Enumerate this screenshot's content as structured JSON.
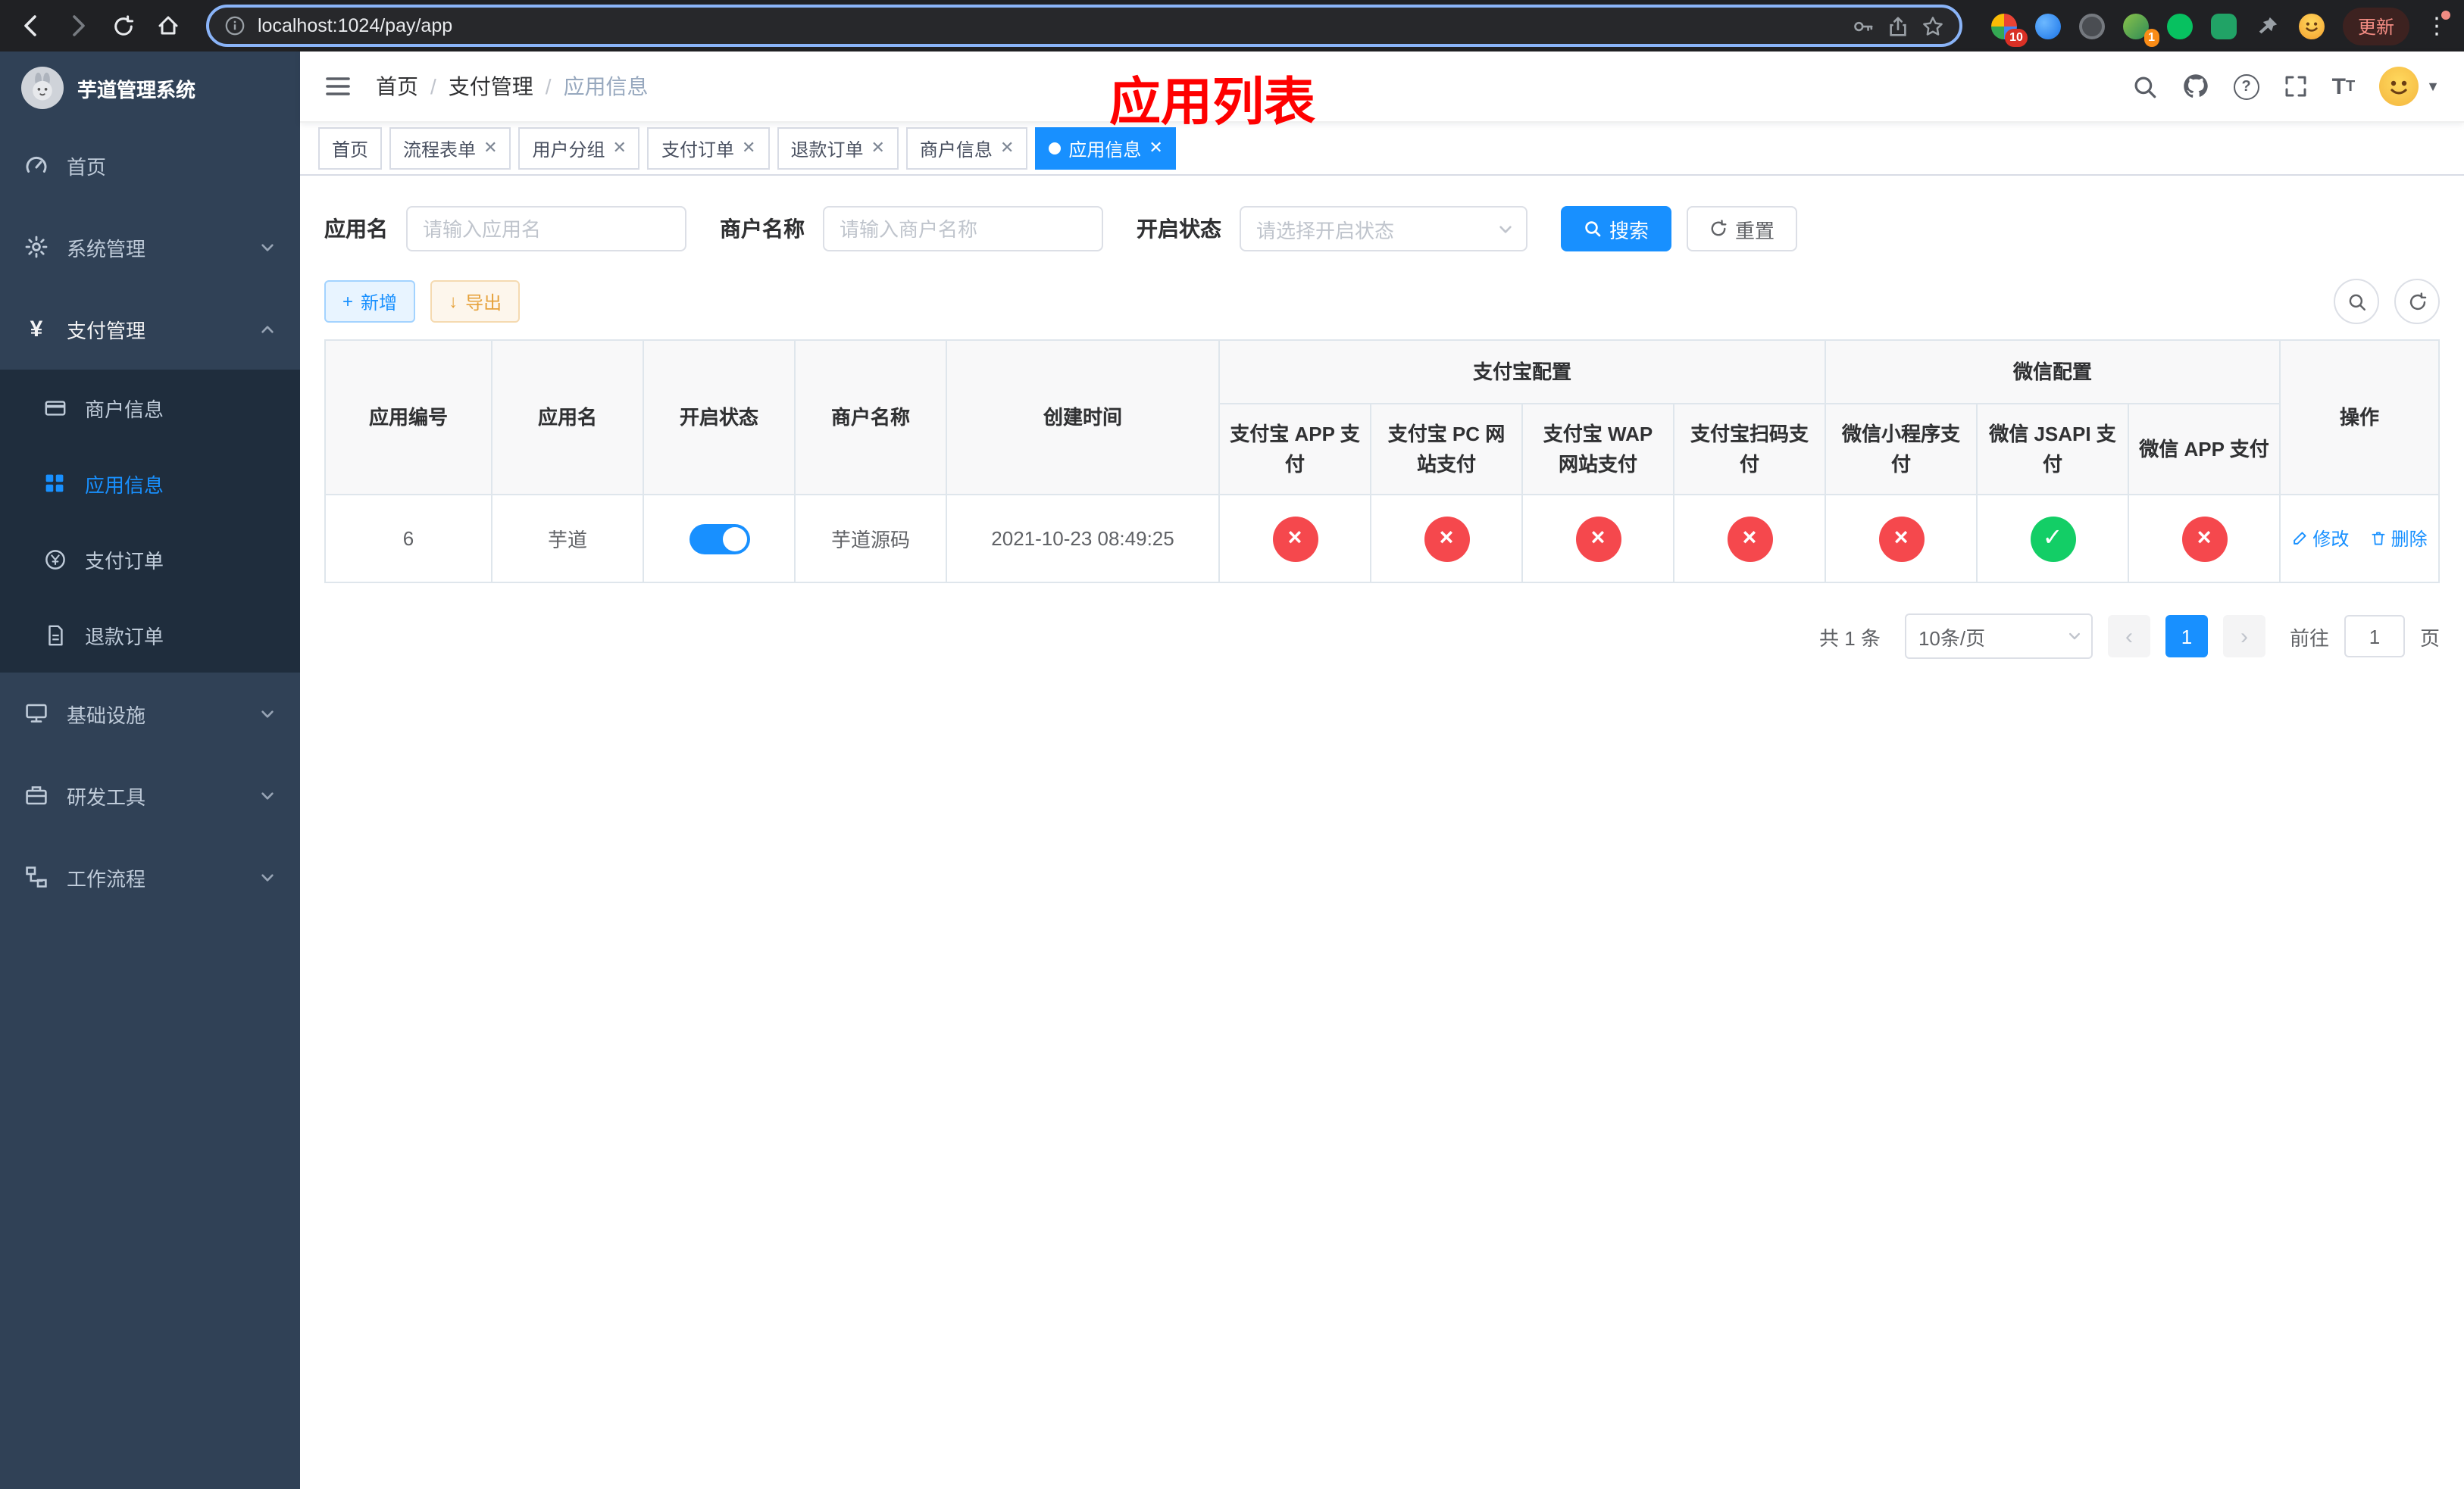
{
  "browser": {
    "url": "localhost:1024/pay/app",
    "update_label": "更新",
    "ext_badge": "10",
    "avatar_badge": "1"
  },
  "app": {
    "title": "芋道管理系统"
  },
  "sidebar": {
    "items": [
      {
        "label": "首页"
      },
      {
        "label": "系统管理"
      },
      {
        "label": "支付管理"
      },
      {
        "label": "基础设施"
      },
      {
        "label": "研发工具"
      },
      {
        "label": "工作流程"
      }
    ],
    "children": [
      {
        "label": "商户信息"
      },
      {
        "label": "应用信息"
      },
      {
        "label": "支付订单"
      },
      {
        "label": "退款订单"
      }
    ]
  },
  "breadcrumb": {
    "home": "首页",
    "section": "支付管理",
    "current": "应用信息"
  },
  "annotation": {
    "title": "应用列表"
  },
  "tabs": [
    {
      "label": "首页"
    },
    {
      "label": "流程表单"
    },
    {
      "label": "用户分组"
    },
    {
      "label": "支付订单"
    },
    {
      "label": "退款订单"
    },
    {
      "label": "商户信息"
    },
    {
      "label": "应用信息"
    }
  ],
  "filters": {
    "app_name": {
      "label": "应用名",
      "placeholder": "请输入应用名",
      "value": ""
    },
    "merchant": {
      "label": "商户名称",
      "placeholder": "请输入商户名称",
      "value": ""
    },
    "status": {
      "label": "开启状态",
      "placeholder": "请选择开启状态"
    },
    "search_label": "搜索",
    "reset_label": "重置"
  },
  "toolbar": {
    "add_label": "新增",
    "export_label": "导出"
  },
  "table": {
    "columns": {
      "app_id": "应用编号",
      "app_name": "应用名",
      "status": "开启状态",
      "merchant": "商户名称",
      "created": "创建时间",
      "alipay_group": "支付宝配置",
      "wechat_group": "微信配置",
      "actions": "操作",
      "alipay": [
        "支付宝 APP 支付",
        "支付宝 PC 网站支付",
        "支付宝 WAP 网站支付",
        "支付宝扫码支付"
      ],
      "wechat": [
        "微信小程序支付",
        "微信 JSAPI 支付",
        "微信 APP 支付"
      ]
    },
    "rows": [
      {
        "app_id": "6",
        "app_name": "芋道",
        "status_on": true,
        "merchant": "芋道源码",
        "created": "2021-10-23 08:49:25",
        "alipay_status": [
          "no",
          "no",
          "no",
          "no"
        ],
        "wechat_status": [
          "no",
          "yes",
          "no"
        ],
        "edit_label": "修改",
        "delete_label": "删除"
      }
    ]
  },
  "pagination": {
    "total": "共 1 条",
    "page_size": "10条/页",
    "page": "1",
    "goto_label": "前往",
    "goto_value": "1",
    "unit": "页"
  },
  "colors": {
    "primary": "#1890ff",
    "danger": "#f5484d",
    "success": "#13ce66",
    "sidebar_bg": "#304156",
    "annotation_red": "#fe0000"
  },
  "icons": {
    "back-icon": "arrow-left",
    "forward-icon": "arrow-right",
    "reload-icon": "circular-arrow",
    "home-icon": "house",
    "info-icon": "circled-i",
    "key-icon": "key",
    "share-icon": "box-arrow-up",
    "bookmark-star-icon": "star",
    "search-icon": "magnifier",
    "github-icon": "octocat",
    "help-icon": "question-circle",
    "fullscreen-icon": "corner-brackets",
    "font-size-icon": "T",
    "hamburger-icon": "three-lines",
    "chevron-down-icon": "chevron",
    "check-icon": "check",
    "cross-icon": "cross",
    "edit-icon": "pencil",
    "delete-icon": "trash",
    "add-icon": "plus",
    "export-icon": "arrow-down",
    "refresh-icon": "circular-arrow"
  }
}
